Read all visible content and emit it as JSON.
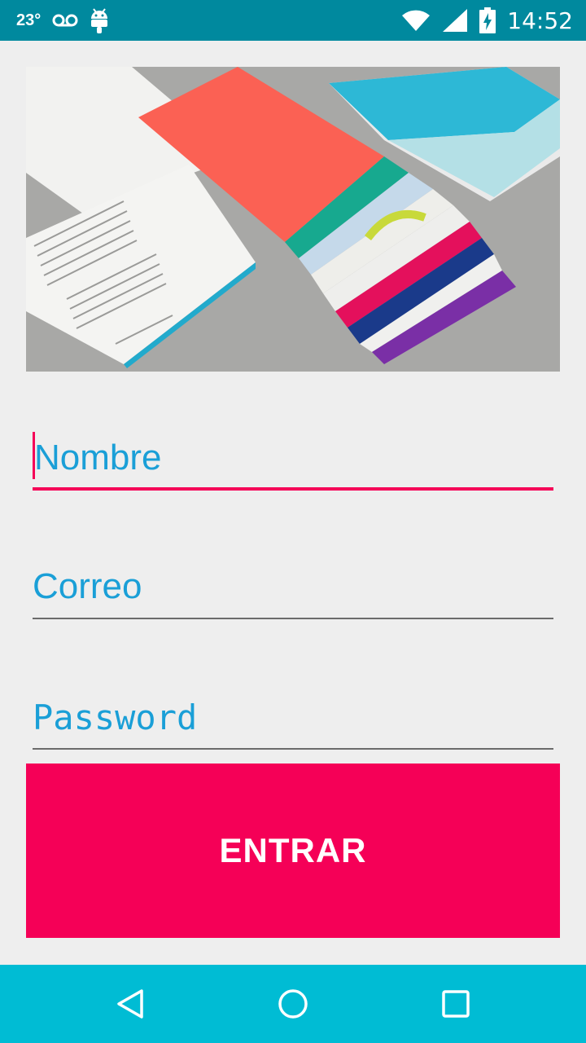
{
  "status_bar": {
    "temperature": "23°",
    "time": "14:52",
    "icons": [
      "voicemail-icon",
      "android-icon",
      "wifi-icon",
      "signal-icon",
      "battery-charging-icon"
    ]
  },
  "hero_image": {
    "description_icon": "material-design-booklets-image"
  },
  "form": {
    "name_placeholder": "Nombre",
    "email_placeholder": "Correo",
    "password_placeholder": "Password",
    "submit_label": "ENTRAR"
  },
  "colors": {
    "status_bar": "#00899e",
    "navigation_bar": "#00bcd4",
    "accent": "#f50057",
    "hint_text": "#1a9fd7",
    "background": "#eeeeee"
  },
  "navigation_bar": {
    "buttons": [
      "back-icon",
      "home-icon",
      "recents-icon"
    ]
  }
}
